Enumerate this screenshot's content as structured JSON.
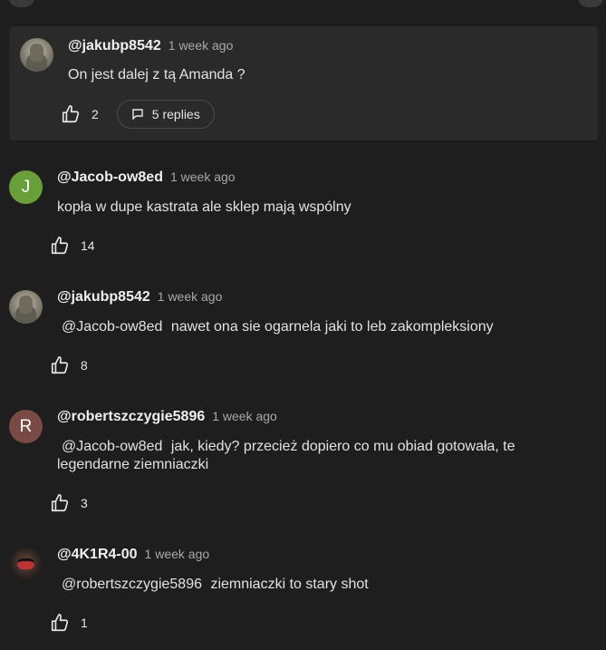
{
  "thread": {
    "top": {
      "author": "@jakubp8542",
      "time": "1 week ago",
      "text": "On jest dalej z tą Amanda ?",
      "likes": "2",
      "replies": "5 replies"
    },
    "comments": [
      {
        "avatar_letter": "J",
        "author": "@Jacob-ow8ed",
        "time": "1 week ago",
        "text": "kopła w dupe kastrata ale sklep mają wspólny",
        "likes": "14"
      },
      {
        "author": "@jakubp8542",
        "time": "1 week ago",
        "mention": "@Jacob-ow8ed",
        "text": "nawet ona sie ogarnela jaki to leb zakompleksiony",
        "likes": "8"
      },
      {
        "avatar_letter": "R",
        "author": "@robertszczygie5896",
        "time": "1 week ago",
        "mention": "@Jacob-ow8ed",
        "text": "jak, kiedy? przecież dopiero co mu obiad gotowała, te legendarne ziemniaczki",
        "likes": "3"
      },
      {
        "author": "@4K1R4-00",
        "time": "1 week ago",
        "mention": "@robertszczygie5896",
        "text": "ziemniaczki to stary shot",
        "likes": "1"
      }
    ]
  }
}
